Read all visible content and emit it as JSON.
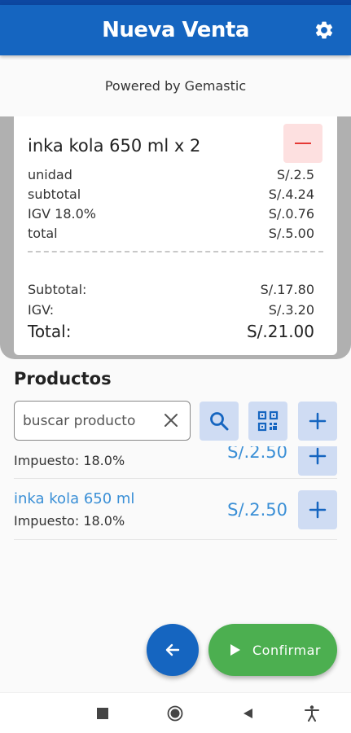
{
  "app_bar": {
    "title": "Nueva Venta",
    "settings_icon": "gear-icon"
  },
  "powered_by": "Powered by Gemastic",
  "receipt": {
    "item": {
      "title": "inka kola 650 ml x 2",
      "remove_icon": "minus-icon",
      "rows": [
        {
          "label": "unidad",
          "value": "S/.2.5"
        },
        {
          "label": "subtotal",
          "value": "S/.4.24"
        },
        {
          "label": "IGV 18.0%",
          "value": "S/.0.76"
        },
        {
          "label": "total",
          "value": "S/.5.00"
        }
      ]
    },
    "summary": {
      "subtotal_label": "Subtotal:",
      "subtotal_value": "S/.17.80",
      "igv_label": "IGV:",
      "igv_value": "S/.3.20",
      "total_label": "Total:",
      "total_value": "S/.21.00"
    }
  },
  "products": {
    "heading": "Productos",
    "search": {
      "placeholder": "buscar producto",
      "value": ""
    },
    "list": [
      {
        "name": "",
        "tax": "Impuesto: 18.0%",
        "price": "S/.2.50"
      },
      {
        "name": "inka kola 650 ml",
        "tax": "Impuesto: 18.0%",
        "price": "S/.2.50"
      }
    ]
  },
  "actions": {
    "confirm_label": "Confirmar"
  },
  "colors": {
    "primary": "#1565c0",
    "accent_green": "#4caf50",
    "link_blue": "#3a8fd6",
    "danger": "#e53935"
  }
}
